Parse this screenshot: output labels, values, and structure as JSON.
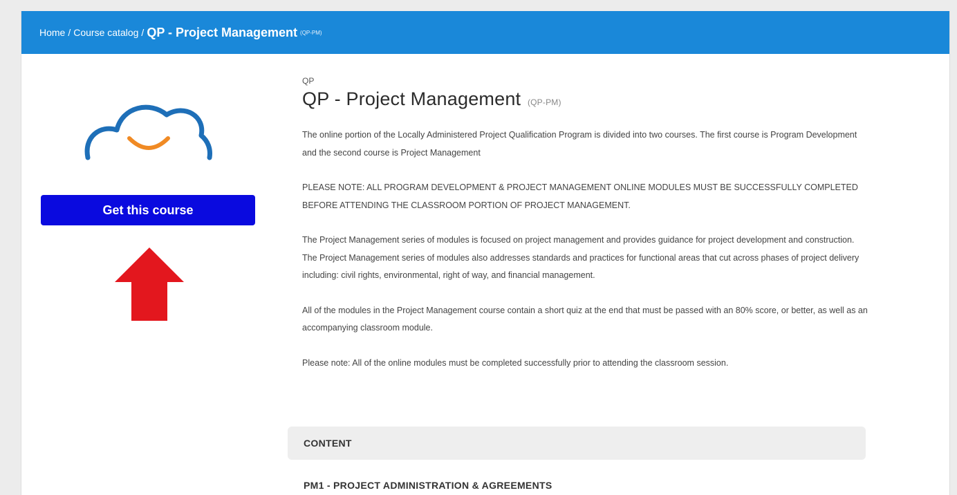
{
  "breadcrumb": {
    "home": "Home",
    "separator": "/",
    "catalog": "Course catalog",
    "current": "QP - Project Management",
    "current_code": "(QP-PM)"
  },
  "course": {
    "category": "QP",
    "title": "QP - Project Management",
    "code": "(QP-PM)",
    "get_button_label": "Get this course",
    "description": [
      "The online portion of the Locally Administered Project Qualification Program is divided into two courses. The first course is Program Development and the second course is Project Management",
      "PLEASE NOTE: ALL PROGRAM DEVELOPMENT & PROJECT MANAGEMENT ONLINE MODULES MUST BE SUCCESSFULLY COMPLETED BEFORE ATTENDING THE CLASSROOM PORTION OF PROJECT MANAGEMENT.",
      "The Project Management series of modules is focused on project management and provides guidance for project development and construction. The Project Management series of modules also addresses standards and practices for functional areas that cut across phases of project delivery including: civil rights, environmental, right of way, and financial management.",
      "All of the modules in the Project Management course contain a short quiz at the end that must be passed with an 80% score, or better, as well as an accompanying classroom module.",
      "Please note: All of the online modules must be completed successfully prior to attending the classroom session."
    ]
  },
  "content": {
    "header": "CONTENT",
    "modules": [
      "PM1 - PROJECT ADMINISTRATION & AGREEMENTS"
    ]
  },
  "icons": {
    "logo": "cloud-smile-logo-icon",
    "arrow": "up-arrow-icon"
  },
  "colors": {
    "topbar": "#1a88d9",
    "button": "#0a0adf",
    "logo_cloud": "#1e6fb8",
    "logo_smile": "#f08a24",
    "arrow": "#e3171e"
  }
}
